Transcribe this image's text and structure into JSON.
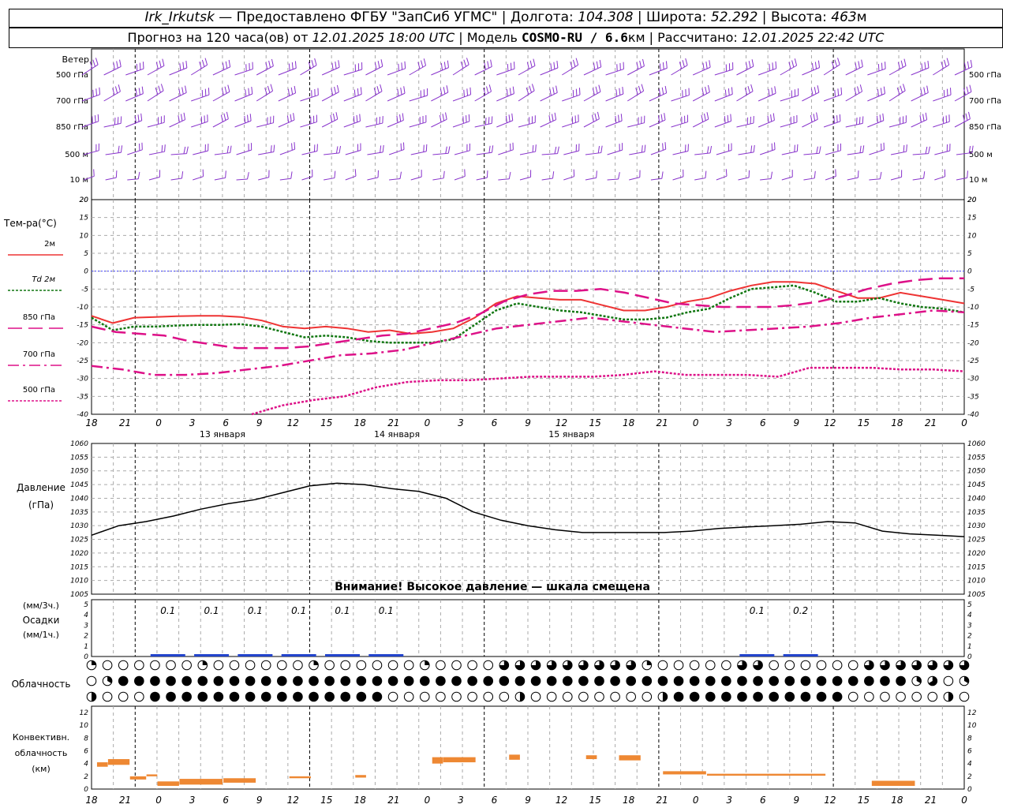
{
  "header": {
    "station": "Irk_Irkutsk",
    "provider": "— Предоставлено ФГБУ \"ЗапСиб УГМС\"",
    "lon_label": "Долгота:",
    "lon": "104.308",
    "lat_label": "Широта:",
    "lat": "52.292",
    "alt_label": "Высота:",
    "alt": "463",
    "alt_unit": "м",
    "forecast_label": "Прогноз на 120 часа(ов) от",
    "forecast_start": "12.01.2025 18:00 UTC",
    "model_label": "Модель",
    "model": "COSMO-RU / 6.6",
    "model_unit": "км",
    "calc_label": "Рассчитано:",
    "calc_time": "12.01.2025 22:42 UTC"
  },
  "colors": {
    "t2m": "#ee3333",
    "td2m": "#117711",
    "t850": "#dd1188",
    "t700": "#dd1188",
    "t500": "#dd1188",
    "wind": "#8833cc",
    "pressure": "#000000",
    "precip": "#2244cc",
    "conv": "#ee8833",
    "zero": "#4444ff"
  },
  "chart_data": [
    {
      "type": "barbs",
      "panel": "wind",
      "title": "Ветер",
      "levels": [
        "500 гПа",
        "700 гПа",
        "850 гПа",
        "500 м",
        "10 м"
      ],
      "time_step_hours": 3,
      "ylim": [
        0,
        20
      ],
      "y_ticks": [
        20
      ]
    },
    {
      "type": "line",
      "panel": "temperature",
      "title": "Тем-ра(°С)",
      "ylim": [
        -40,
        20
      ],
      "y_ticks": [
        20,
        15,
        10,
        5,
        0,
        -5,
        -10,
        -15,
        -20,
        -25,
        -30,
        -35,
        -40
      ],
      "x_ticks": [
        "18",
        "21",
        "0",
        "3",
        "6",
        "9",
        "12",
        "15",
        "18",
        "21",
        "0",
        "3",
        "6",
        "9",
        "12",
        "15",
        "18",
        "21",
        "0",
        "3",
        "6",
        "9",
        "12",
        "15",
        "18",
        "21",
        "0"
      ],
      "day_labels": [
        "13 января",
        "14 января",
        "15 января"
      ],
      "series": [
        {
          "name": "2м",
          "style": "solid",
          "values": [
            -12.5,
            -14.5,
            -13,
            -12.8,
            -12.6,
            -12.5,
            -12.5,
            -12.8,
            -13.8,
            -15.5,
            -16,
            -15.5,
            -16,
            -17,
            -16.5,
            -17.5,
            -17,
            -16,
            -13,
            -9,
            -7,
            -7.5,
            -8,
            -8,
            -9.5,
            -11,
            -11,
            -10,
            -8.5,
            -7.5,
            -5.5,
            -4,
            -3,
            -3,
            -3.5,
            -5.5,
            -7.5,
            -7.5,
            -6,
            -7,
            -8,
            -9
          ]
        },
        {
          "name": "Td 2м",
          "style": "dotted",
          "values": [
            -13,
            -16.5,
            -15.5,
            -15.5,
            -15.2,
            -15,
            -15,
            -14.8,
            -15.5,
            -17,
            -18.5,
            -18,
            -18.5,
            -19.5,
            -20,
            -20,
            -20,
            -19,
            -15,
            -11,
            -9,
            -10,
            -11,
            -11.5,
            -12.5,
            -13.5,
            -13.5,
            -13,
            -11.5,
            -10.5,
            -7.5,
            -5,
            -4.5,
            -4,
            -6,
            -8.5,
            -8.5,
            -7.5,
            -9,
            -10,
            -10.5,
            -11.5
          ]
        },
        {
          "name": "850 гПа",
          "style": "long-dash",
          "values": [
            -15.5,
            -17,
            -17.5,
            -18,
            -19.5,
            -20.5,
            -21.5,
            -21.5,
            -21.5,
            -21,
            -20,
            -19,
            -18,
            -17.5,
            -16,
            -14.5,
            -12,
            -8.5,
            -6.5,
            -5.5,
            -5.5,
            -5,
            -6,
            -7.5,
            -9,
            -9.5,
            -10,
            -10,
            -10,
            -9.5,
            -8.5,
            -7,
            -5,
            -3.5,
            -2.5,
            -2,
            -2
          ]
        },
        {
          "name": "700 гПа",
          "style": "dash-dot",
          "values": [
            -26.5,
            -27.5,
            -29,
            -29,
            -28.5,
            -27.5,
            -26.5,
            -25,
            -23.5,
            -23,
            -22,
            -20,
            -18,
            -16,
            -15,
            -14,
            -13,
            -14,
            -15,
            -16,
            -17,
            -16.5,
            -16,
            -15.5,
            -14.5,
            -13,
            -12,
            -11,
            -11.5
          ]
        },
        {
          "name": "500 гПа",
          "style": "dotted",
          "values": [
            -40,
            -37.5,
            -36,
            -35,
            -32.5,
            -31,
            -30.5,
            -30.5,
            -30,
            -29.5,
            -29.5,
            -29.5,
            -29,
            -28,
            -29,
            -29,
            -29,
            -29.5,
            -27,
            -27,
            -27,
            -27.5,
            -27.5,
            -28
          ]
        }
      ]
    },
    {
      "type": "line",
      "panel": "pressure",
      "title": "Давление",
      "unit": "(гПа)",
      "ylim": [
        1005,
        1060
      ],
      "y_ticks": [
        1060,
        1055,
        1050,
        1045,
        1040,
        1035,
        1030,
        1025,
        1020,
        1015,
        1010,
        1005
      ],
      "series": [
        {
          "name": "Давление",
          "values": [
            1026.5,
            1030,
            1031.5,
            1033.5,
            1036,
            1038,
            1039.5,
            1042,
            1044.5,
            1045.5,
            1045,
            1043.5,
            1042.5,
            1040,
            1035,
            1032,
            1030,
            1028.5,
            1027.5,
            1027.5,
            1027.5,
            1027.5,
            1028,
            1029,
            1029.5,
            1030,
            1030.5,
            1031.5,
            1031,
            1028,
            1027,
            1026.5,
            1026
          ]
        }
      ]
    },
    {
      "type": "bar",
      "panel": "precipitation",
      "title": "Осадки",
      "units_top": "(мм/3ч.)",
      "units_bottom": "(мм/1ч.)",
      "ylim": [
        0,
        5
      ],
      "y_ticks": [
        5,
        4,
        3,
        2,
        1,
        0
      ],
      "labels": [
        "0.1",
        "0.1",
        "0.1",
        "0.1",
        "0.1",
        "0.1",
        "0.1",
        "0.2"
      ],
      "values_mm_3h": [
        0.1,
        0.1,
        0.1,
        0.1,
        0.1,
        0.1,
        0.1,
        0.2
      ]
    },
    {
      "type": "table",
      "panel": "clouds",
      "title": "Облачность",
      "rows": 3
    },
    {
      "type": "bar",
      "panel": "convective",
      "title": "Конвективн. облачность",
      "unit": "(км)",
      "ylim": [
        0,
        13
      ],
      "y_ticks": [
        12,
        10,
        8,
        6,
        4,
        2,
        0
      ]
    }
  ],
  "warning": "Внимание! Высокое давление — шкала смещена"
}
